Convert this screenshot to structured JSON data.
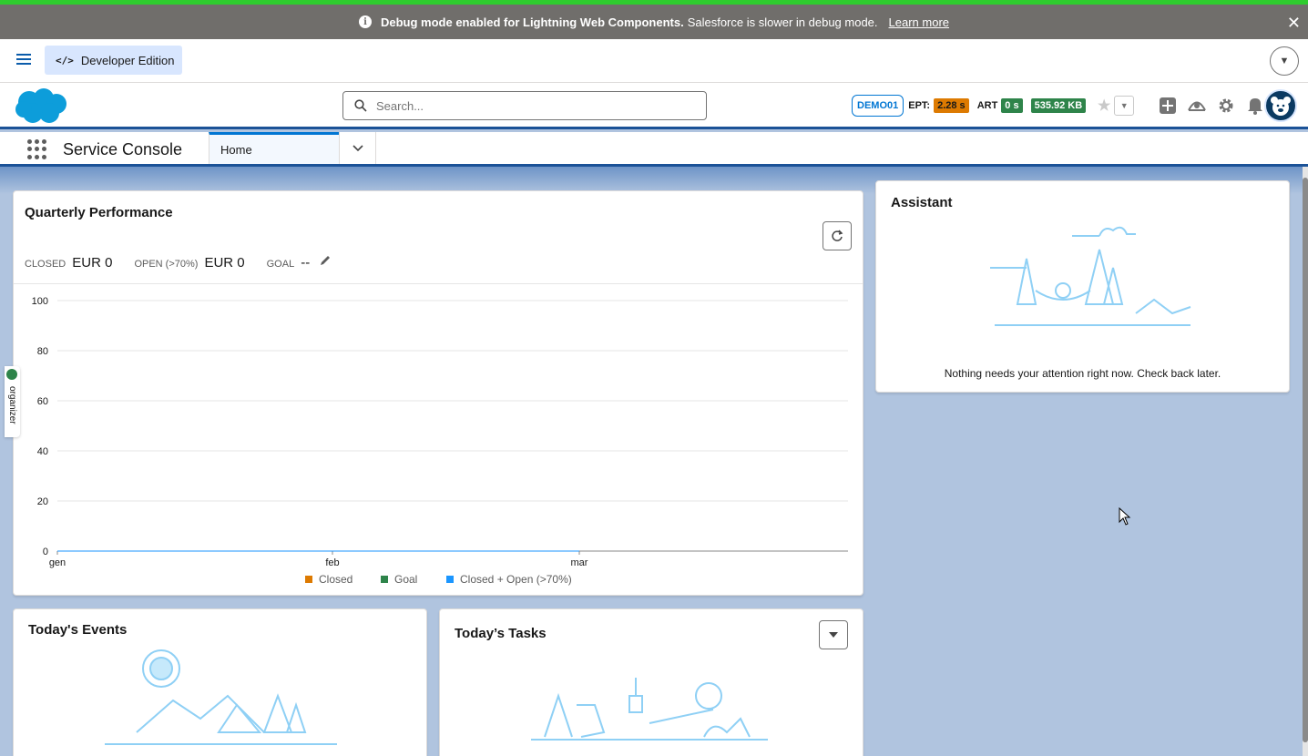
{
  "debug_banner": {
    "bold_text": "Debug mode enabled for Lightning Web Components.",
    "text": "Salesforce is slower in debug mode.",
    "link": "Learn more",
    "close": "✕"
  },
  "dev_bar": {
    "edition_label": "Developer Edition",
    "code_icon": "</>"
  },
  "header": {
    "search_placeholder": "Search...",
    "org_badge": "DEMO01",
    "ept_label": "EPT:",
    "ept_value": "2.28 s",
    "art_label": "ART",
    "art_value": "0 s",
    "memory_value": "535.92 KB"
  },
  "nav": {
    "app_name": "Service Console",
    "tabs": [
      {
        "label": "Home"
      }
    ]
  },
  "quarterly": {
    "title": "Quarterly Performance",
    "closed_label": "CLOSED",
    "closed_value": "EUR 0",
    "open_label": "OPEN (>70%)",
    "open_value": "EUR 0",
    "goal_label": "GOAL",
    "goal_value": "--"
  },
  "chart_data": {
    "type": "line",
    "categories": [
      "gen",
      "feb",
      "mar"
    ],
    "yticks": [
      0,
      20,
      40,
      60,
      80,
      100
    ],
    "ylim": [
      0,
      100
    ],
    "series": [
      {
        "name": "Closed",
        "color": "#dd7a01",
        "values": [
          0,
          0,
          0
        ]
      },
      {
        "name": "Goal",
        "color": "#2e844a",
        "values": [
          0,
          0,
          0
        ]
      },
      {
        "name": "Closed + Open (>70%)",
        "color": "#1b96ff",
        "values": [
          0,
          0,
          0
        ]
      }
    ],
    "legend": "bottom",
    "grid": true
  },
  "assistant": {
    "title": "Assistant",
    "message": "Nothing needs your attention right now. Check back later."
  },
  "events": {
    "title": "Today's Events"
  },
  "tasks": {
    "title": "Today’s Tasks"
  },
  "organizer": {
    "label": "organizer"
  }
}
